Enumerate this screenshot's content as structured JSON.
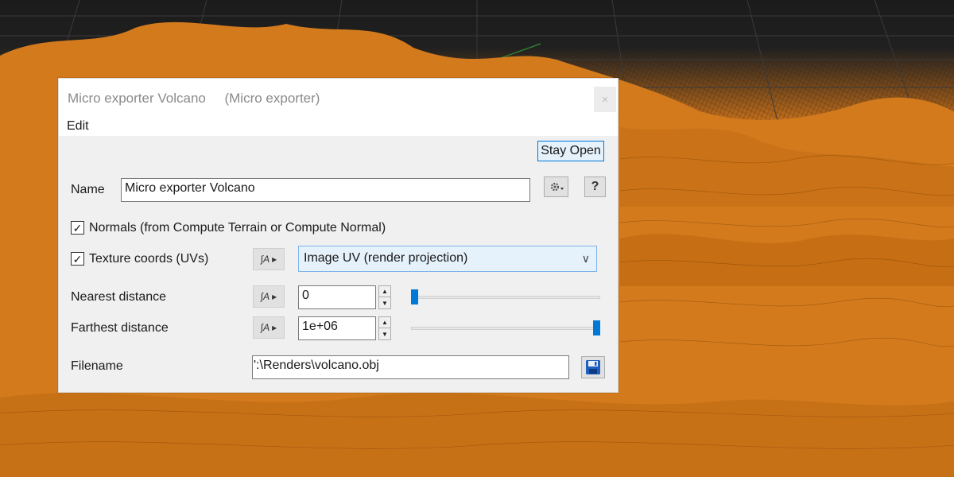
{
  "dialog": {
    "title": "Micro exporter Volcano     (Micro exporter)",
    "close_glyph": "×",
    "menu": {
      "edit_label": "Edit"
    },
    "stay_open_label": "Stay Open",
    "name": {
      "label": "Name",
      "value": "Micro exporter Volcano"
    },
    "gear_icon": "gear-icon",
    "help_label": "?",
    "normals": {
      "checked": true,
      "label": "Normals (from Compute Terrain or Compute Normal)"
    },
    "texture_coords": {
      "checked": true,
      "label": "Texture coords (UVs)",
      "selected_option": "Image UV (render projection)"
    },
    "nearest_distance": {
      "label": "Nearest distance",
      "value": "0",
      "slider_fraction": 0.0
    },
    "farthest_distance": {
      "label": "Farthest distance",
      "value": "1e+06",
      "slider_fraction": 1.0
    },
    "filename": {
      "label": "Filename",
      "value": "':\\Renders\\volcano.obj"
    },
    "anim_glyph": "∫A ▸",
    "accent_color": "#0078d7",
    "save_icon": "floppy-disk-icon"
  },
  "scene": {
    "terrain_color": "#d8821f",
    "grid_color": "#3a3a3a"
  }
}
